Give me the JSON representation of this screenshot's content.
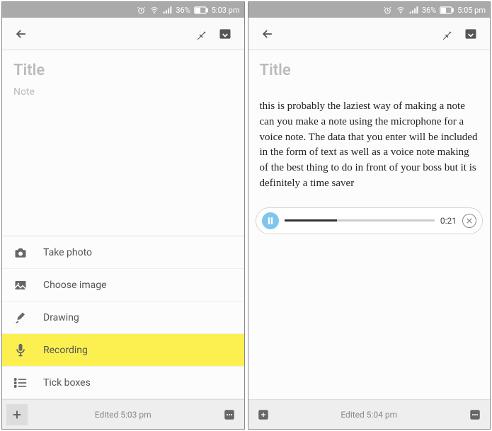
{
  "left": {
    "status": {
      "battery": "36%",
      "time": "5:03 pm"
    },
    "title_placeholder": "Title",
    "note_placeholder": "Note",
    "attach": [
      {
        "icon": "camera-icon",
        "label": "Take photo",
        "highlight": false
      },
      {
        "icon": "image-icon",
        "label": "Choose image",
        "highlight": false
      },
      {
        "icon": "brush-icon",
        "label": "Drawing",
        "highlight": false
      },
      {
        "icon": "mic-icon",
        "label": "Recording",
        "highlight": true
      },
      {
        "icon": "list-icon",
        "label": "Tick boxes",
        "highlight": false
      }
    ],
    "edited": "Edited 5:03 pm"
  },
  "right": {
    "status": {
      "battery": "36%",
      "time": "5:05 pm"
    },
    "title_placeholder": "Title",
    "note_body": "this is probably the laziest way of making a note can you make a note using the microphone for a voice note. The data that you enter will be included in the form of text as well as a voice note making of the best thing to do in front of your boss but it is definitely a time saver",
    "audio": {
      "elapsed": "0:21",
      "progress_pct": 35
    },
    "edited": "Edited 5:04 pm"
  }
}
